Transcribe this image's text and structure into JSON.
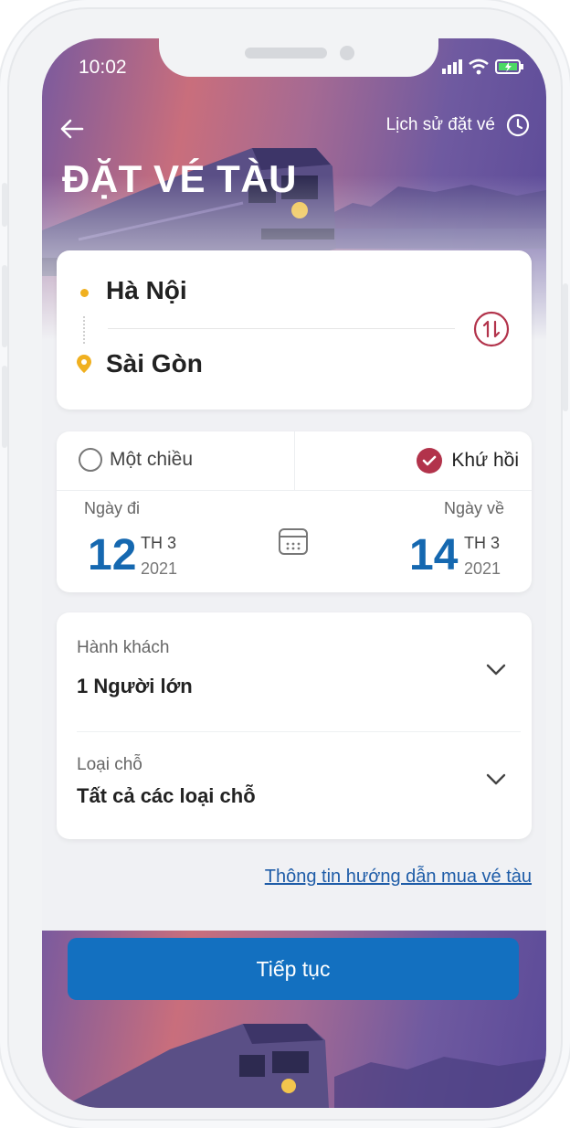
{
  "status_bar": {
    "time": "10:02"
  },
  "header": {
    "history_label": "Lịch sử đặt vé",
    "title": "ĐẶT VÉ TÀU"
  },
  "route": {
    "from": "Hà Nội",
    "to": "Sài Gòn"
  },
  "trip_type": {
    "one_way_label": "Một chiều",
    "round_trip_label": "Khứ hồi",
    "selected": "round_trip"
  },
  "depart": {
    "label": "Ngày đi",
    "day": "12",
    "month": "TH 3",
    "year": "2021"
  },
  "return": {
    "label": "Ngày về",
    "day": "14",
    "month": "TH 3",
    "year": "2021"
  },
  "passengers": {
    "label": "Hành khách",
    "value": "1 Người lớn"
  },
  "seat_type": {
    "label": "Loại chỗ",
    "value": "Tất cả các loại chỗ"
  },
  "guide_link": "Thông tin hướng dẫn mua vé tàu",
  "continue_button": "Tiếp tục",
  "colors": {
    "primary_blue": "#1370c0",
    "date_blue": "#1568b0",
    "accent_red": "#b2334b",
    "dot_yellow": "#f0b020"
  },
  "icons": [
    "back-arrow-icon",
    "clock-icon",
    "swap-icon",
    "location-pin-icon",
    "check-icon",
    "calendar-icon",
    "chevron-down-icon",
    "signal-icon",
    "wifi-icon",
    "battery-icon"
  ]
}
